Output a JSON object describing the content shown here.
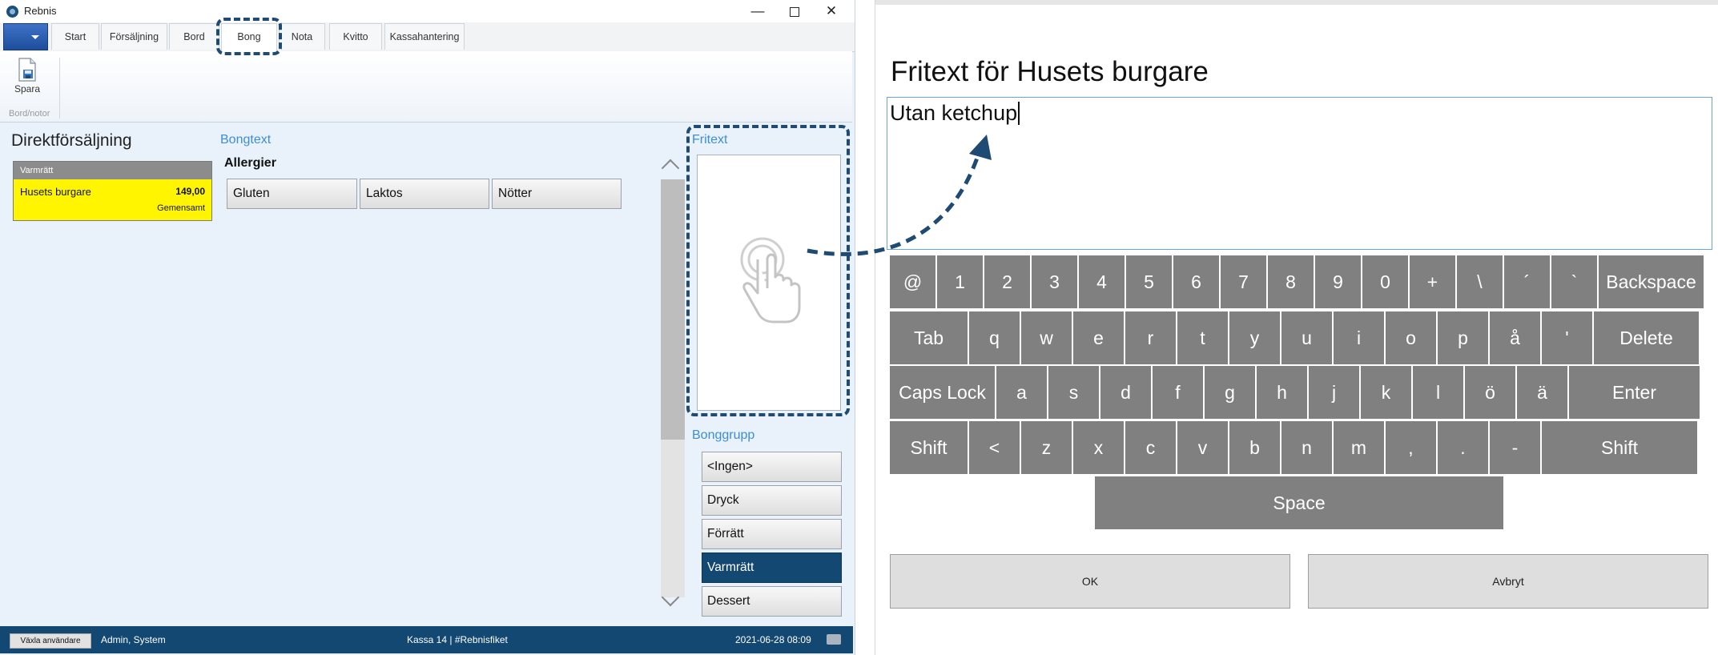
{
  "window": {
    "app_title": "Rebnis",
    "controls": {
      "minimize": "—",
      "close": "✕"
    }
  },
  "tabs": [
    {
      "label": "Start"
    },
    {
      "label": "Försäljning"
    },
    {
      "label": "Bord"
    },
    {
      "label": "Bong",
      "active": true
    },
    {
      "label": "Nota"
    },
    {
      "label": "Kvitto"
    },
    {
      "label": "Kassahantering"
    }
  ],
  "ribbon": {
    "save_label": "Spara",
    "group_label": "Bord/notor",
    "save_icon": "save-document-icon"
  },
  "main": {
    "title": "Direktförsäljning",
    "order": {
      "category": "Varmrätt",
      "item": "Husets burgare",
      "price": "149,00",
      "group": "Gemensamt",
      "color": "#fff500"
    },
    "bongtext_label": "Bongtext",
    "allergies_label": "Allergier",
    "allergies": [
      "Gluten",
      "Laktos",
      "Nötter"
    ],
    "fritext_label": "Fritext",
    "bonggrupp_label": "Bonggrupp",
    "bonggrupp": [
      {
        "label": "<Ingen>"
      },
      {
        "label": "Dryck"
      },
      {
        "label": "Förrätt"
      },
      {
        "label": "Varmrätt",
        "selected": true
      },
      {
        "label": "Dessert"
      }
    ]
  },
  "status": {
    "switch_user": "Växla användare",
    "user": "Admin, System",
    "kassa": "Kassa 14 | #Rebnisfiket",
    "datetime": "2021-06-28 08:09"
  },
  "dialog": {
    "title": "Fritext för Husets burgare",
    "text_value": "Utan ketchup",
    "ok_label": "OK",
    "cancel_label": "Avbryt"
  },
  "keyboard": {
    "row1": [
      "@",
      "1",
      "2",
      "3",
      "4",
      "5",
      "6",
      "7",
      "8",
      "9",
      "0",
      "+",
      "\\",
      "´",
      "`",
      "Backspace"
    ],
    "row2": [
      "Tab",
      "q",
      "w",
      "e",
      "r",
      "t",
      "y",
      "u",
      "i",
      "o",
      "p",
      "å",
      "'",
      "Delete"
    ],
    "row3": [
      "Caps Lock",
      "a",
      "s",
      "d",
      "f",
      "g",
      "h",
      "j",
      "k",
      "l",
      "ö",
      "ä",
      "Enter"
    ],
    "row4": [
      "Shift",
      "<",
      "z",
      "x",
      "c",
      "v",
      "b",
      "n",
      "m",
      ",",
      ".",
      "-",
      "Shift"
    ],
    "space": "Space"
  },
  "colors": {
    "accent": "#134872",
    "highlight": "#1f4a73",
    "label_blue": "#3c8ed8",
    "key_gray": "#808080"
  }
}
